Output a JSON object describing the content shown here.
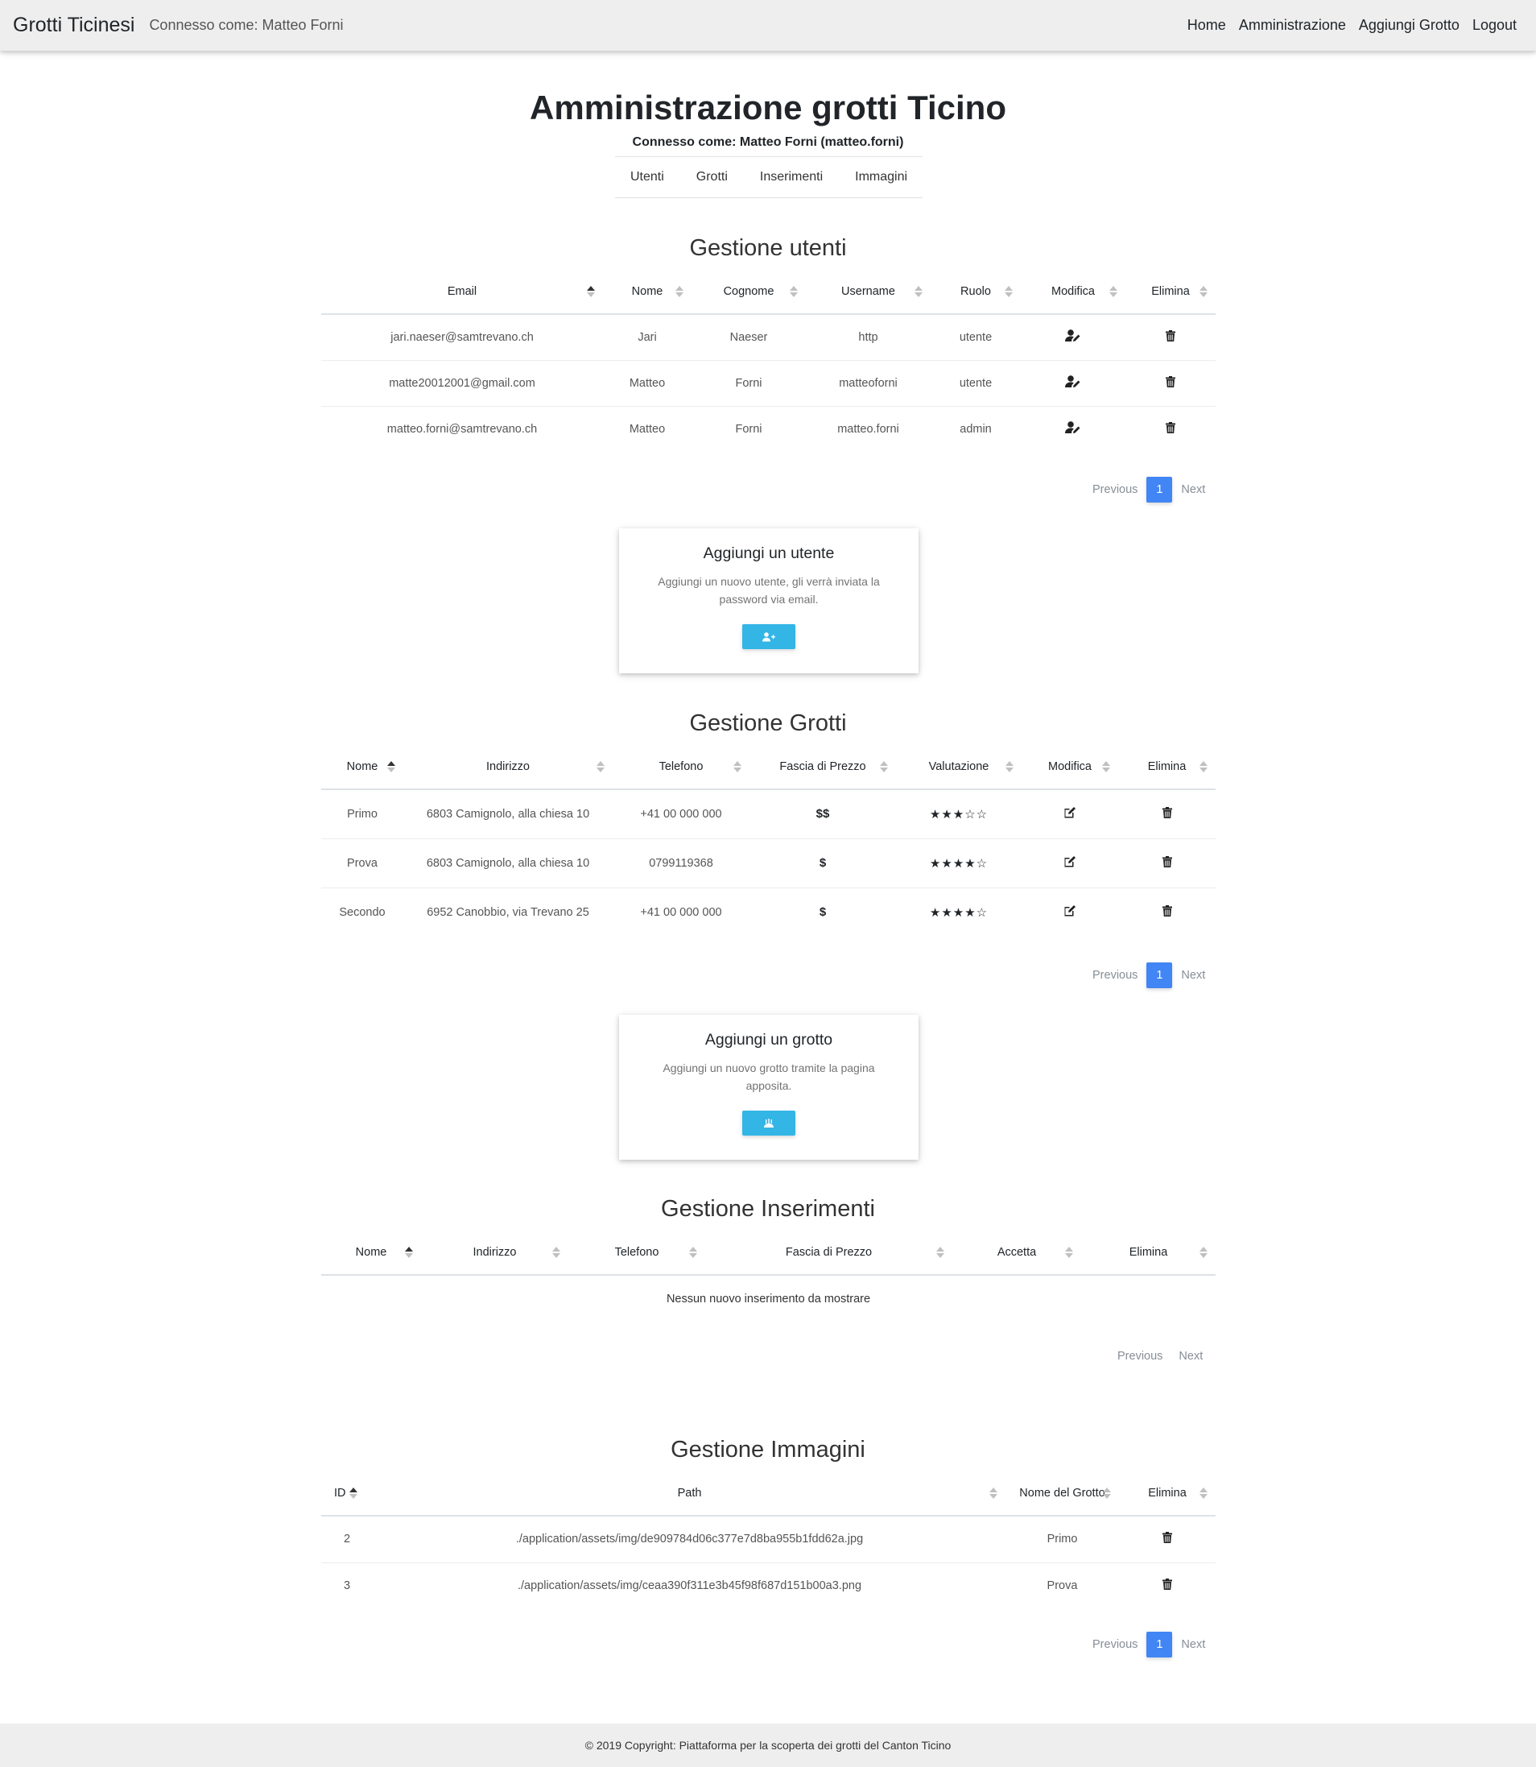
{
  "nav": {
    "brand": "Grotti Ticinesi",
    "connected": "Connesso come: Matteo Forni",
    "links": [
      "Home",
      "Amministrazione",
      "Aggiungi Grotto",
      "Logout"
    ]
  },
  "header": {
    "title": "Amministrazione grotti Ticino",
    "subtitle": "Connesso come: Matteo Forni (matteo.forni)",
    "tabs": [
      "Utenti",
      "Grotti",
      "Inserimenti",
      "Immagini"
    ]
  },
  "users": {
    "title": "Gestione utenti",
    "columns": [
      "Email",
      "Nome",
      "Cognome",
      "Username",
      "Ruolo",
      "Modifica",
      "Elimina"
    ],
    "rows": [
      {
        "email": "jari.naeser@samtrevano.ch",
        "nome": "Jari",
        "cognome": "Naeser",
        "username": "http",
        "ruolo": "utente"
      },
      {
        "email": "matte20012001@gmail.com",
        "nome": "Matteo",
        "cognome": "Forni",
        "username": "matteoforni",
        "ruolo": "utente"
      },
      {
        "email": "matteo.forni@samtrevano.ch",
        "nome": "Matteo",
        "cognome": "Forni",
        "username": "matteo.forni",
        "ruolo": "admin"
      }
    ],
    "pager": {
      "prev": "Previous",
      "page": "1",
      "next": "Next"
    },
    "card": {
      "title": "Aggiungi un utente",
      "text": "Aggiungi un nuovo utente, gli verrà inviata la password via email."
    }
  },
  "grotti": {
    "title": "Gestione Grotti",
    "columns": [
      "Nome",
      "Indirizzo",
      "Telefono",
      "Fascia di Prezzo",
      "Valutazione",
      "Modifica",
      "Elimina"
    ],
    "rows": [
      {
        "nome": "Primo",
        "indirizzo": "6803 Camignolo, alla chiesa 10",
        "telefono": "+41 00 000 000",
        "prezzo": "$$",
        "stars": "★★★☆☆",
        "rating": 3
      },
      {
        "nome": "Prova",
        "indirizzo": "6803 Camignolo, alla chiesa 10",
        "telefono": "0799119368",
        "prezzo": "$",
        "stars": "★★★★☆",
        "rating": 4
      },
      {
        "nome": "Secondo",
        "indirizzo": "6952 Canobbio, via Trevano 25",
        "telefono": "+41 00 000 000",
        "prezzo": "$",
        "stars": "★★★★☆",
        "rating": 4
      }
    ],
    "pager": {
      "prev": "Previous",
      "page": "1",
      "next": "Next"
    },
    "card": {
      "title": "Aggiungi un grotto",
      "text": "Aggiungi un nuovo grotto tramite la pagina apposita."
    }
  },
  "inserimenti": {
    "title": "Gestione Inserimenti",
    "columns": [
      "Nome",
      "Indirizzo",
      "Telefono",
      "Fascia di Prezzo",
      "Accetta",
      "Elimina"
    ],
    "empty": "Nessun nuovo inserimento da mostrare",
    "pager": {
      "prev": "Previous",
      "next": "Next"
    }
  },
  "immagini": {
    "title": "Gestione Immagini",
    "columns": [
      "ID",
      "Path",
      "Nome del Grotto",
      "Elimina"
    ],
    "rows": [
      {
        "id": "2",
        "path": "./application/assets/img/de909784d06c377e7d8ba955b1fdd62a.jpg",
        "grotto": "Primo"
      },
      {
        "id": "3",
        "path": "./application/assets/img/ceaa390f311e3b45f98f687d151b00a3.png",
        "grotto": "Prova"
      }
    ],
    "pager": {
      "prev": "Previous",
      "page": "1",
      "next": "Next"
    }
  },
  "footer": {
    "text": "© 2019 Copyright: Piattaforma per la scoperta dei grotti del Canton Ticino"
  },
  "colors": {
    "accent": "#4285f4",
    "card_button": "#33b5e5",
    "navbar": "#eeeeee"
  }
}
